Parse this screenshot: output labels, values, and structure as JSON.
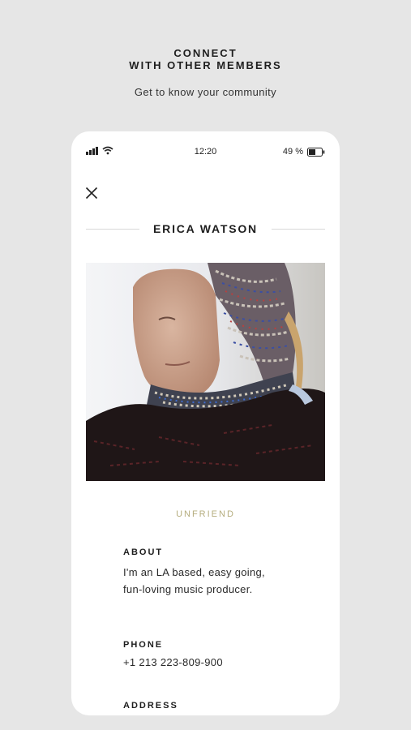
{
  "header": {
    "title_line1": "CONNECT",
    "title_line2": "WITH OTHER MEMBERS",
    "subtitle": "Get to know your community"
  },
  "status_bar": {
    "time": "12:20",
    "battery": "49 %"
  },
  "profile": {
    "name": "ERICA WATSON",
    "action_label": "UNFRIEND",
    "about_label": "ABOUT",
    "about_text": "I'm an LA based, easy going, fun-loving music producer.",
    "phone_label": "PHONE",
    "phone_value": "+1 213 223-809-900",
    "address_label": "ADDRESS"
  },
  "colors": {
    "background": "#e6e6e6",
    "card": "#ffffff",
    "accent": "#b5ad7e"
  },
  "icons": {
    "close": "close-icon",
    "signal": "signal-icon",
    "wifi": "wifi-icon",
    "battery": "battery-icon"
  }
}
